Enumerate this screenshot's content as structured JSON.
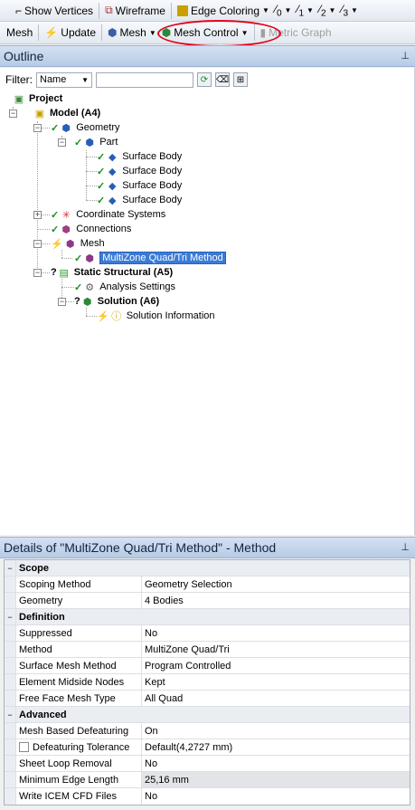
{
  "toolbar1": {
    "show_vertices": "Show Vertices",
    "wireframe": "Wireframe",
    "edge_coloring": "Edge Coloring",
    "edge_tool_1": "0",
    "edge_tool_2": "1",
    "edge_tool_3": "2",
    "edge_tool_4": "3"
  },
  "toolbar2": {
    "mesh_label": "Mesh",
    "update": "Update",
    "mesh_dropdown": "Mesh",
    "mesh_control": "Mesh Control",
    "metric_graph": "Metric Graph"
  },
  "outline": {
    "title": "Outline",
    "filter_label": "Filter:",
    "filter_value": "Name",
    "tree": {
      "project": "Project",
      "model": "Model (A4)",
      "geometry": "Geometry",
      "part": "Part",
      "bodies": [
        "Surface Body",
        "Surface Body",
        "Surface Body",
        "Surface Body"
      ],
      "coordinate_systems": "Coordinate Systems",
      "connections": "Connections",
      "mesh": "Mesh",
      "multizone": "MultiZone Quad/Tri Method",
      "static_structural": "Static Structural (A5)",
      "analysis_settings": "Analysis Settings",
      "solution": "Solution (A6)",
      "solution_information": "Solution Information"
    }
  },
  "details": {
    "title": "Details of \"MultiZone Quad/Tri Method\" - Method",
    "sections": [
      {
        "name": "Scope",
        "rows": [
          {
            "key": "Scoping Method",
            "value": "Geometry Selection"
          },
          {
            "key": "Geometry",
            "value": "4 Bodies"
          }
        ]
      },
      {
        "name": "Definition",
        "rows": [
          {
            "key": "Suppressed",
            "value": "No"
          },
          {
            "key": "Method",
            "value": "MultiZone Quad/Tri"
          },
          {
            "key": "Surface Mesh Method",
            "value": "Program Controlled"
          },
          {
            "key": "Element Midside Nodes",
            "value": "Kept"
          },
          {
            "key": "Free Face Mesh Type",
            "value": "All Quad"
          }
        ]
      },
      {
        "name": "Advanced",
        "rows": [
          {
            "key": "Mesh Based Defeaturing",
            "value": "On"
          },
          {
            "key": "Defeaturing Tolerance",
            "value": "Default(4,2727 mm)"
          },
          {
            "key": "Sheet Loop Removal",
            "value": "No"
          },
          {
            "key": "Minimum Edge Length",
            "value": "25,16 mm"
          },
          {
            "key": "Write ICEM CFD Files",
            "value": "No"
          }
        ]
      }
    ]
  }
}
